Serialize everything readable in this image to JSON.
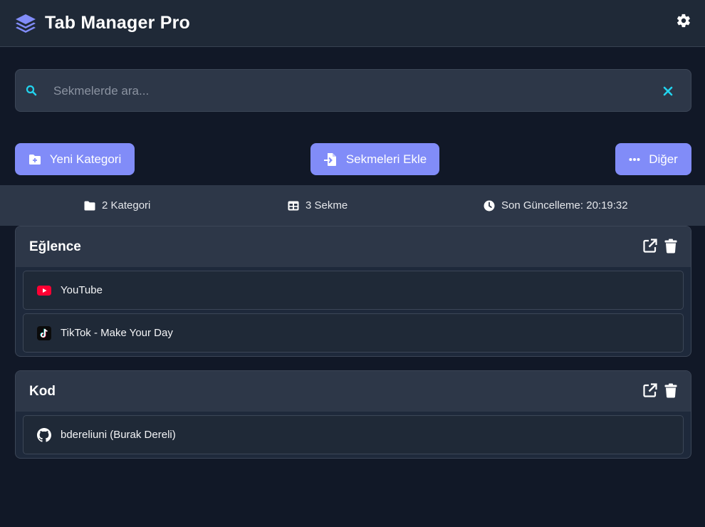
{
  "header": {
    "title": "Tab Manager Pro",
    "logo_icon": "layers-icon",
    "settings_icon": "gear-icon"
  },
  "search": {
    "placeholder": "Sekmelerde ara...",
    "value": "",
    "search_icon": "search-icon",
    "clear_icon": "close-icon"
  },
  "actions": {
    "new_category": "Yeni Kategori",
    "add_tabs": "Sekmeleri Ekle",
    "more": "Diğer"
  },
  "stats": {
    "categories": "2 Kategori",
    "tabs": "3 Sekme",
    "last_update": "Son Güncelleme: 20:19:32"
  },
  "categories": [
    {
      "name": "Eğlence",
      "tabs": [
        {
          "title": "YouTube",
          "icon": "youtube-icon"
        },
        {
          "title": "TikTok - Make Your Day",
          "icon": "tiktok-icon"
        }
      ]
    },
    {
      "name": "Kod",
      "tabs": [
        {
          "title": "bdereliuni (Burak Dereli)",
          "icon": "github-icon"
        }
      ]
    }
  ],
  "colors": {
    "background": "#111827",
    "panel": "#2d3748",
    "accent": "#818cf8",
    "search_accent": "#22d3ee"
  }
}
